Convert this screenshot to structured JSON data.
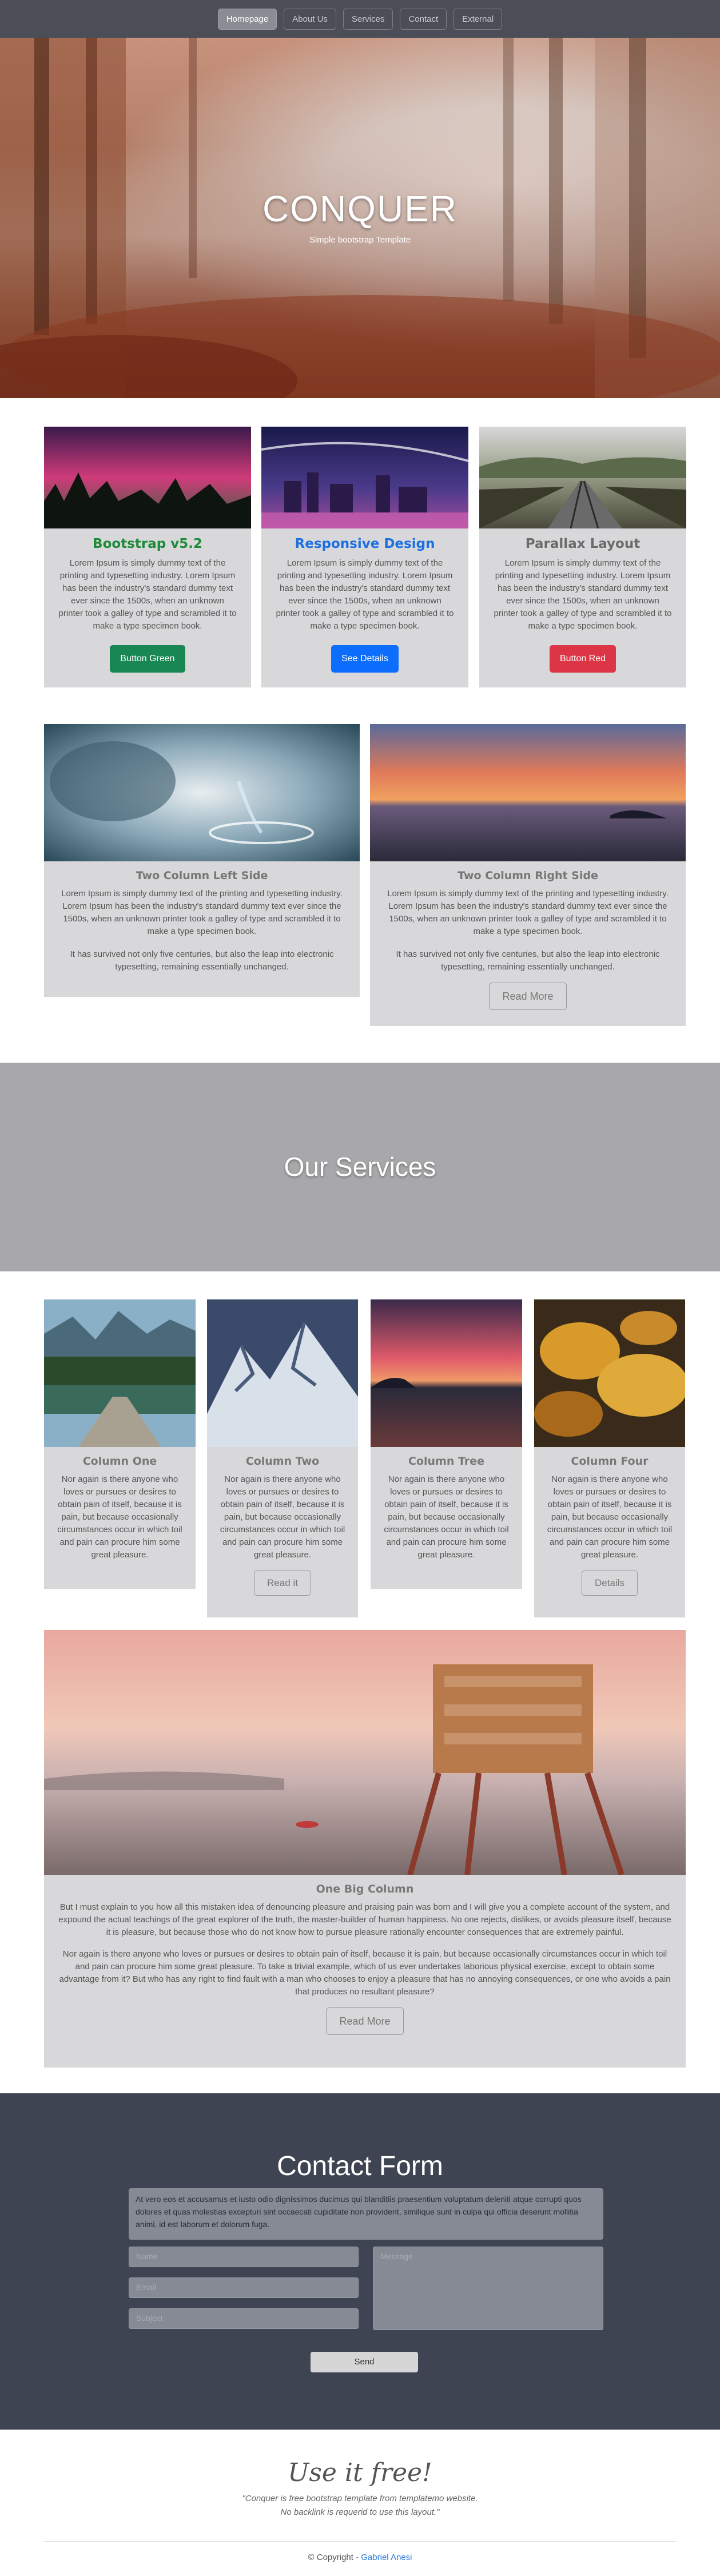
{
  "nav": {
    "items": [
      "Homepage",
      "About Us",
      "Services",
      "Contact",
      "External"
    ]
  },
  "hero": {
    "title": "CONQUER",
    "subtitle": "Simple bootstrap Template"
  },
  "features": [
    {
      "title": "Bootstrap v5.2",
      "title_color": "#1e8a3a",
      "text": "Lorem Ipsum is simply dummy text of the printing and typesetting industry. Lorem Ipsum has been the industry's standard dummy text ever since the 1500s, when an unknown printer took a galley of type and scrambled it to make a type specimen book.",
      "button": "Button Green",
      "button_color": "#198754"
    },
    {
      "title": "Responsive Design",
      "title_color": "#1e6fe0",
      "text": "Lorem Ipsum is simply dummy text of the printing and typesetting industry. Lorem Ipsum has been the industry's standard dummy text ever since the 1500s, when an unknown printer took a galley of type and scrambled it to make a type specimen book.",
      "button": "See Details",
      "button_color": "#0d6efd"
    },
    {
      "title": "Parallax Layout",
      "title_color": "#6b6b6b",
      "text": "Lorem Ipsum is simply dummy text of the printing and typesetting industry. Lorem Ipsum has been the industry's standard dummy text ever since the 1500s, when an unknown printer took a galley of type and scrambled it to make a type specimen book.",
      "button": "Button Red",
      "button_color": "#dc3545"
    }
  ],
  "two_column": {
    "left": {
      "title": "Two Column Left Side",
      "p1": "Lorem Ipsum is simply dummy text of the printing and typesetting industry. Lorem Ipsum has been the industry's standard dummy text ever since the 1500s, when an unknown printer took a galley of type and scrambled it to make a type specimen book.",
      "p2": "It has survived not only five centuries, but also the leap into electronic typesetting, remaining essentially unchanged."
    },
    "right": {
      "title": "Two Column Right Side",
      "p1": "Lorem Ipsum is simply dummy text of the printing and typesetting industry. Lorem Ipsum has been the industry's standard dummy text ever since the 1500s, when an unknown printer took a galley of type and scrambled it to make a type specimen book.",
      "p2": "It has survived not only five centuries, but also the leap into electronic typesetting, remaining essentially unchanged.",
      "button": "Read More"
    }
  },
  "services": {
    "heading": "Our Services",
    "columns": [
      {
        "title": "Column One",
        "text": "Nor again is there anyone who loves or pursues or desires to obtain pain of itself, because it is pain, but because occasionally circumstances occur in which toil and pain can procure him some great pleasure."
      },
      {
        "title": "Column Two",
        "text": "Nor again is there anyone who loves or pursues or desires to obtain pain of itself, because it is pain, but because occasionally circumstances occur in which toil and pain can procure him some great pleasure.",
        "button": "Read it"
      },
      {
        "title": "Column Tree",
        "text": "Nor again is there anyone who loves or pursues or desires to obtain pain of itself, because it is pain, but because occasionally circumstances occur in which toil and pain can procure him some great pleasure."
      },
      {
        "title": "Column Four",
        "text": "Nor again is there anyone who loves or pursues or desires to obtain pain of itself, because it is pain, but because occasionally circumstances occur in which toil and pain can procure him some great pleasure.",
        "button": "Details"
      }
    ]
  },
  "big_column": {
    "title": "One Big Column",
    "p1": "But I must explain to you how all this mistaken idea of denouncing pleasure and praising pain was born and I will give you a complete account of the system, and expound the actual teachings of the great explorer of the truth, the master-builder of human happiness. No one rejects, dislikes, or avoids pleasure itself, because it is pleasure, but because those who do not know how to pursue pleasure rationally encounter consequences that are extremely painful.",
    "p2": "Nor again is there anyone who loves or pursues or desires to obtain pain of itself, because it is pain, but because occasionally circumstances occur in which toil and pain can procure him some great pleasure. To take a trivial example, which of us ever undertakes laborious physical exercise, except to obtain some advantage from it? But who has any right to find fault with a man who chooses to enjoy a pleasure that has no annoying consequences, or one who avoids a pain that produces no resultant pleasure?",
    "button": "Read More"
  },
  "contact": {
    "heading": "Contact Form",
    "note": "At vero eos et accusamus et iusto odio dignissimos ducimus qui blanditiis praesentium voluptatum deleniti atque corrupti quos dolores et quas molestias excepturi sint occaecati cupiditate non provident, similique sunt in culpa qui officia deserunt mollitia animi, id est laborum et dolorum fuga.",
    "name_placeholder": "Name",
    "email_placeholder": "Email",
    "subject_placeholder": "Subject",
    "message_placeholder": "Message",
    "send": "Send"
  },
  "footer": {
    "heading": "Use it free!",
    "line1": "\"Conquer is free bootstrap template from templatemo website.",
    "line2": "No backlink is requerid to use this layout.\"",
    "copyright": "© Copyright - ",
    "author": "Gabriel Anesi"
  }
}
